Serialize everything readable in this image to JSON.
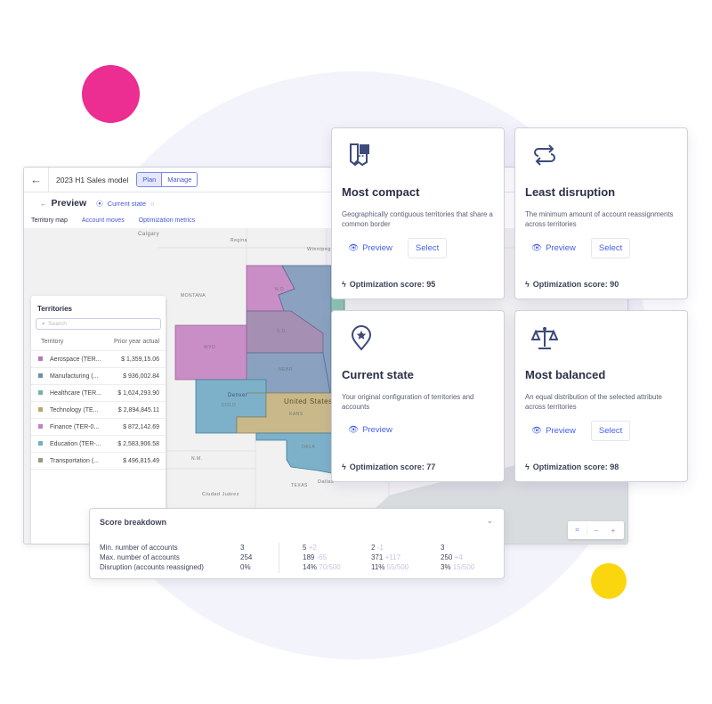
{
  "header": {
    "title": "2023 H1 Sales model",
    "tabs": [
      "Plan",
      "Manage"
    ]
  },
  "preview": {
    "title": "Preview",
    "state": "Current state"
  },
  "view_tabs": [
    "Territory map",
    "Account moves",
    "Optimization metrics"
  ],
  "map_labels": {
    "calgary": "Calgary",
    "regina": "Regina",
    "winnipeg": "Winnipeg",
    "montana": "MONTANA",
    "nd": "N.D.",
    "sd": "S.D.",
    "wyo": "WYO",
    "nebr": "NEBR",
    "denver": "Denver",
    "colo": "COLO",
    "us": "United States",
    "kans": "KANS",
    "okla": "OKLA",
    "nm": "N.M.",
    "texas": "TEXAS",
    "dallas": "Dallas",
    "juarez": "Ciudad Juárez"
  },
  "territories": {
    "title": "Territories",
    "search_placeholder": "Search",
    "col_territory": "Territory",
    "col_prior": "Prior year actual",
    "rows": [
      {
        "name": "Aerospace (TER...",
        "value": "$ 1,359,15.06",
        "color": "#b279b8"
      },
      {
        "name": "Manufacturing (...",
        "value": "$ 936,002.84",
        "color": "#6f8fb0"
      },
      {
        "name": "Healthcare (TER...",
        "value": "$ 1,624,293.90",
        "color": "#6fb5a5"
      },
      {
        "name": "Technology (TE...",
        "value": "$ 2,894,845.11",
        "color": "#b5a86e"
      },
      {
        "name": "Finance (TER-0...",
        "value": "$ 872,142.69",
        "color": "#c77fc4"
      },
      {
        "name": "Education (TER-...",
        "value": "$ 2,583,906.58",
        "color": "#6fb0c4"
      },
      {
        "name": "Transportation (...",
        "value": "$ 496,815.49",
        "color": "#8fa07a"
      }
    ]
  },
  "cards": [
    {
      "title": "Most compact",
      "desc": "Geographically contiguous territories that share a common border",
      "preview": "Preview",
      "select": "Select",
      "score": "Optimization score: 95",
      "icon": "map-compact-icon"
    },
    {
      "title": "Least disruption",
      "desc": "The minimum amount of account reassignments across territories",
      "preview": "Preview",
      "select": "Select",
      "score": "Optimization score: 90",
      "icon": "arrows-loop-icon"
    },
    {
      "title": "Current state",
      "desc": "Your original configuration of territories and accounts",
      "preview": "Preview",
      "score": "Optimization score: 77",
      "icon": "location-star-icon"
    },
    {
      "title": "Most balanced",
      "desc": "An equal distribution of the selected attribute across territories",
      "preview": "Preview",
      "select": "Select",
      "score": "Optimization score: 98",
      "icon": "scale-icon"
    }
  ],
  "score_breakdown": {
    "title": "Score breakdown",
    "labels": [
      "Min. number of accounts",
      "Max. number of accounts",
      "Disruption (accounts reassigned)"
    ],
    "current": [
      "3",
      "254",
      "0%"
    ],
    "cols": [
      [
        [
          "5",
          "+2"
        ],
        [
          "189",
          "-65"
        ],
        [
          "14%",
          "70/500"
        ]
      ],
      [
        [
          "2",
          "-1"
        ],
        [
          "371",
          "+117"
        ],
        [
          "11%",
          "55/500"
        ]
      ],
      [
        [
          "3",
          ""
        ],
        [
          "250",
          "+4"
        ],
        [
          "3%",
          "15/500"
        ]
      ]
    ]
  },
  "map_controls": {
    "zoom_out": "−",
    "zoom_in": "+"
  },
  "colors": {
    "accent": "#4461e8",
    "pink": "#ec2d91",
    "yellow": "#fad60f"
  }
}
